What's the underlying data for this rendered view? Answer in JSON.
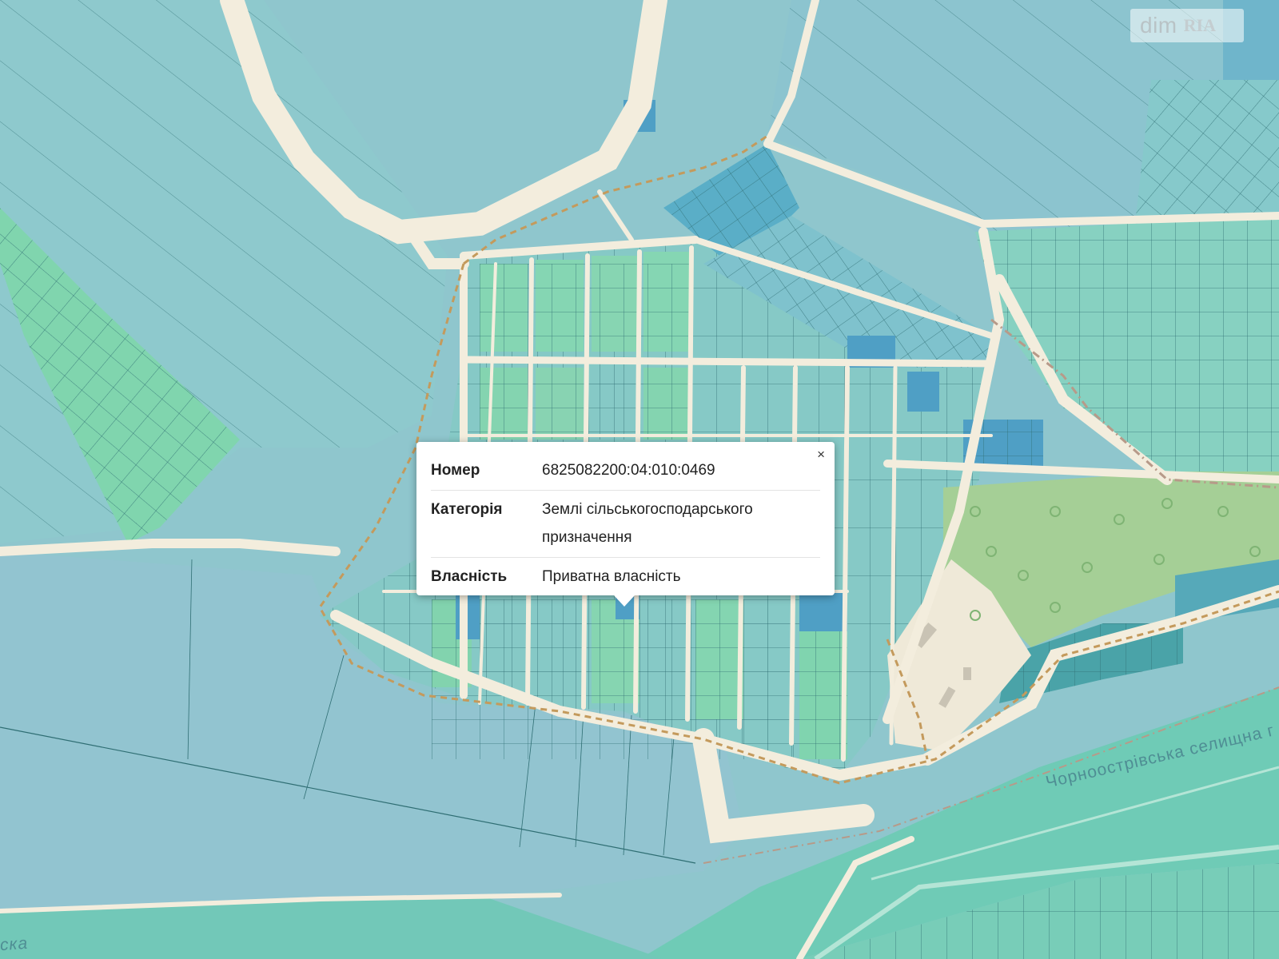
{
  "watermark": {
    "part1": "dim",
    "part2": "RIA"
  },
  "popup": {
    "close_label": "×",
    "rows": [
      {
        "label": "Номер",
        "value": "6825082200:04:010:0469"
      },
      {
        "label": "Категорія",
        "value": "Землі сільськогосподарського призначення"
      },
      {
        "label": "Власність",
        "value": "Приватна власність"
      }
    ]
  },
  "map_labels": {
    "council": "Чорноострівська селищна г",
    "left_edge": "ска"
  },
  "colors": {
    "parcel_green": "#7fd3ad",
    "parcel_teal": "#8ec5cc",
    "parcel_blue": "#5aaec7",
    "forest": "#a3cf94",
    "road": "#f2ecdc",
    "river": "#6dc9b3",
    "boundary": "#c49a5c"
  }
}
